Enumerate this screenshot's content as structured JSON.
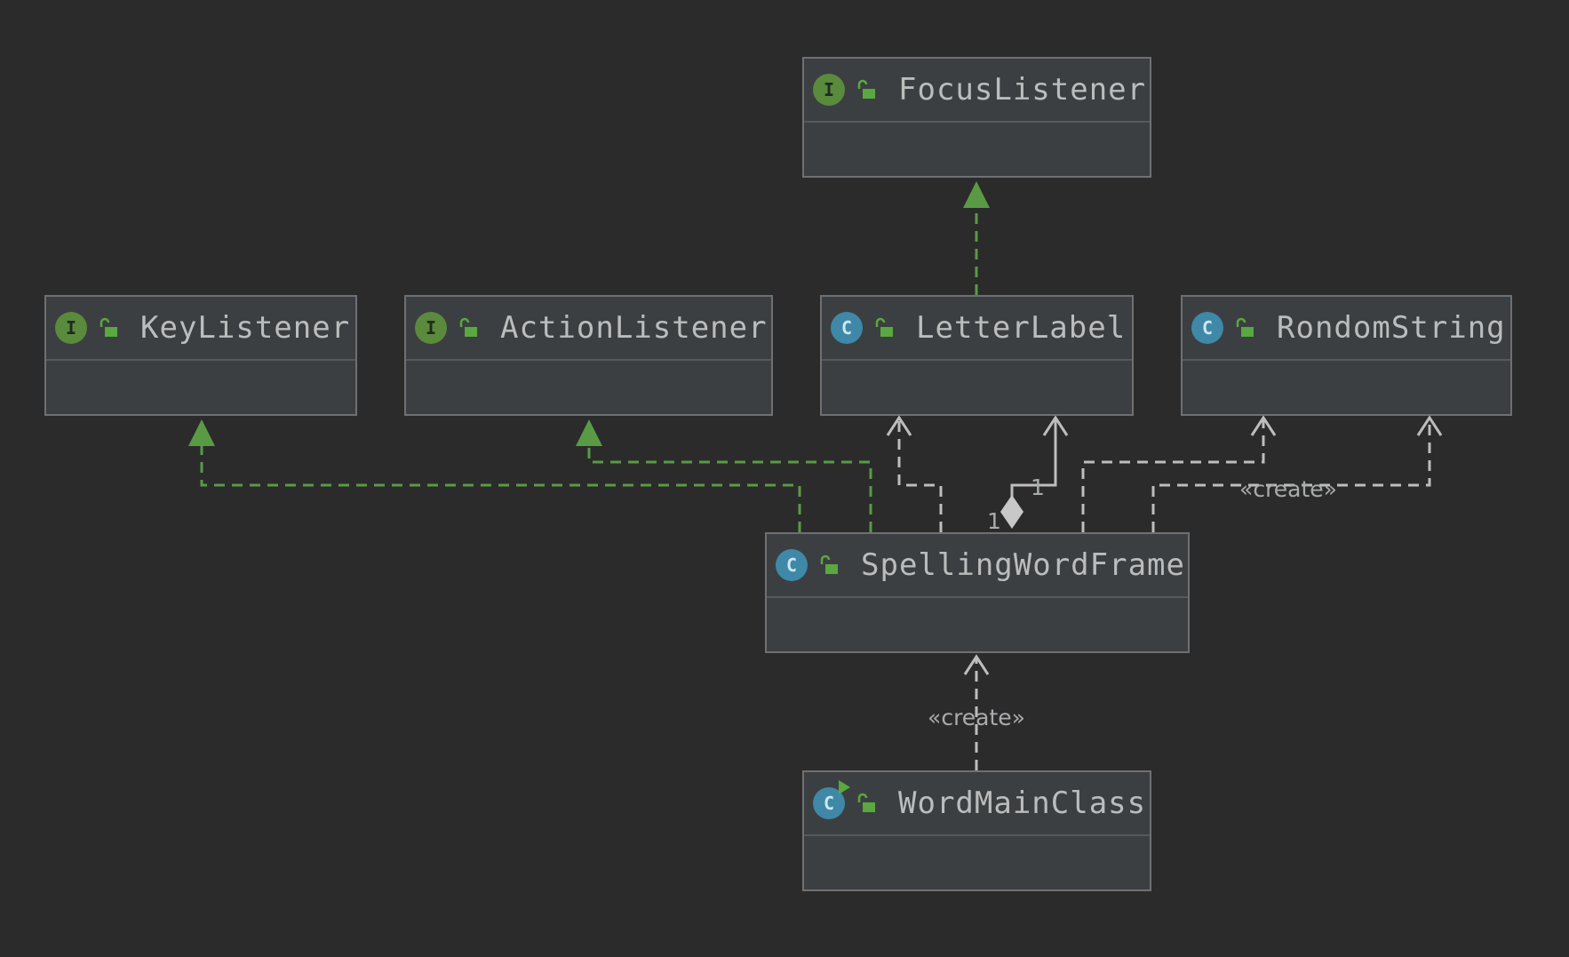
{
  "diagram": {
    "colors": {
      "background": "#2b2b2b",
      "node_fill": "#3c3f41",
      "node_border": "#6e7073",
      "realization_edge": "#5a9a45",
      "dependency_edge": "#bdbdbd",
      "interface_icon": "#5a8a3c",
      "class_icon": "#3f88a8"
    },
    "nodes": [
      {
        "id": "FocusListener",
        "name": "FocusListener",
        "kind": "interface",
        "kind_glyph": "I",
        "visibility_icon": "unlocked-icon"
      },
      {
        "id": "KeyListener",
        "name": "KeyListener",
        "kind": "interface",
        "kind_glyph": "I",
        "visibility_icon": "unlocked-icon"
      },
      {
        "id": "ActionListener",
        "name": "ActionListener",
        "kind": "interface",
        "kind_glyph": "I",
        "visibility_icon": "unlocked-icon"
      },
      {
        "id": "LetterLabel",
        "name": "LetterLabel",
        "kind": "class",
        "kind_glyph": "C",
        "visibility_icon": "unlocked-icon"
      },
      {
        "id": "RondomString",
        "name": "RondomString",
        "kind": "class",
        "kind_glyph": "C",
        "visibility_icon": "unlocked-icon"
      },
      {
        "id": "SpellingWordFrame",
        "name": "SpellingWordFrame",
        "kind": "class",
        "kind_glyph": "C",
        "visibility_icon": "unlocked-icon"
      },
      {
        "id": "WordMainClass",
        "name": "WordMainClass",
        "kind": "main-class",
        "kind_glyph": "C",
        "visibility_icon": "unlocked-icon"
      }
    ],
    "edges": [
      {
        "from": "LetterLabel",
        "to": "FocusListener",
        "type": "realization"
      },
      {
        "from": "SpellingWordFrame",
        "to": "KeyListener",
        "type": "realization"
      },
      {
        "from": "SpellingWordFrame",
        "to": "ActionListener",
        "type": "realization"
      },
      {
        "from": "SpellingWordFrame",
        "to": "LetterLabel",
        "type": "dependency"
      },
      {
        "from": "SpellingWordFrame",
        "to": "LetterLabel",
        "type": "composition",
        "source_multiplicity": "1",
        "target_multiplicity": "1"
      },
      {
        "from": "SpellingWordFrame",
        "to": "RondomString",
        "type": "dependency"
      },
      {
        "from": "SpellingWordFrame",
        "to": "RondomString",
        "type": "dependency",
        "label": "«create»"
      },
      {
        "from": "WordMainClass",
        "to": "SpellingWordFrame",
        "type": "dependency",
        "label": "«create»"
      }
    ]
  }
}
